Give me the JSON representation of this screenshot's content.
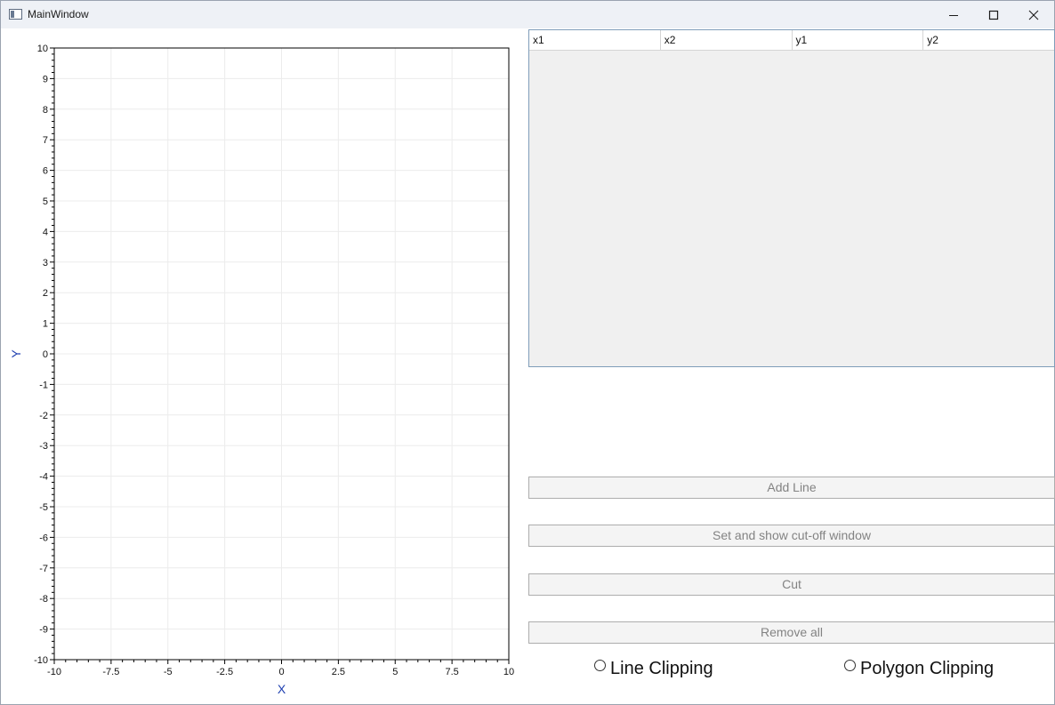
{
  "window": {
    "title": "MainWindow",
    "minimize_icon": "minimize-icon",
    "maximize_icon": "maximize-icon",
    "close_icon": "close-icon"
  },
  "chart_data": {
    "type": "line",
    "title": "",
    "xlabel": "X",
    "ylabel": "Y",
    "xlim": [
      -10,
      10
    ],
    "ylim": [
      -10,
      10
    ],
    "x_ticks": [
      "-10",
      "-7.5",
      "-5",
      "-2.5",
      "0",
      "2.5",
      "5",
      "7.5",
      "10"
    ],
    "x_tick_values": [
      -10,
      -7.5,
      -5,
      -2.5,
      0,
      2.5,
      5,
      7.5,
      10
    ],
    "y_ticks": [
      "10",
      "9",
      "8",
      "7",
      "6",
      "5",
      "4",
      "3",
      "2",
      "1",
      "0",
      "-1",
      "-2",
      "-3",
      "-4",
      "-5",
      "-6",
      "-7",
      "-8",
      "-9",
      "-10"
    ],
    "y_tick_values": [
      10,
      9,
      8,
      7,
      6,
      5,
      4,
      3,
      2,
      1,
      0,
      -1,
      -2,
      -3,
      -4,
      -5,
      -6,
      -7,
      -8,
      -9,
      -10
    ],
    "grid": true,
    "series": [],
    "axis_label_color": "#1e3fb0",
    "grid_color": "#ececec"
  },
  "grid": {
    "columns": [
      "x1",
      "x2",
      "y1",
      "y2"
    ],
    "rows": []
  },
  "buttons": {
    "add_line": "Add Line",
    "set_window": "Set and show cut-off window",
    "cut": "Cut",
    "remove_all": "Remove all"
  },
  "options": {
    "line_clipping": "Line Clipping",
    "polygon_clipping": "Polygon Clipping",
    "line_clipping_checked": false,
    "polygon_clipping_checked": false
  }
}
